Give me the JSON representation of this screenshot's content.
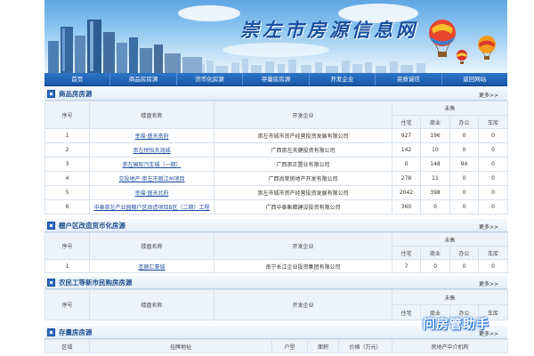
{
  "site": {
    "title": "崇左市房源信息网"
  },
  "nav": {
    "items": [
      "首页",
      "商品房房源",
      "货币化房源",
      "存量房房源",
      "开发企业",
      "资质诚信",
      "返回网站"
    ]
  },
  "sections": {
    "commercial": {
      "title": "商品房房源",
      "more": "更多>>",
      "headers": {
        "no": "序号",
        "name": "楼盘名称",
        "developer": "开发企业",
        "unsold": "未售",
        "res": "住宅",
        "biz": "商业",
        "office": "办公",
        "garage": "车库"
      },
      "rows": [
        {
          "no": "1",
          "name": "幸福·盛天南府",
          "developer": "崇左市城市资产经营投资发展有限公司",
          "res": "927",
          "biz": "196",
          "office": "0",
          "garage": "0"
        },
        {
          "no": "2",
          "name": "崇左悦怡天润城",
          "developer": "广西崇左天健投资有限公司",
          "res": "142",
          "biz": "10",
          "office": "0",
          "garage": "0"
        },
        {
          "no": "3",
          "name": "崇左国际汽车城（一期）",
          "developer": "广西崇正置业有限公司",
          "res": "0",
          "biz": "148",
          "office": "94",
          "garage": "0"
        },
        {
          "no": "4",
          "name": "交投地产·崇左市丽江州项目",
          "developer": "广西尚荣房地产开发有限公司",
          "res": "278",
          "biz": "11",
          "office": "0",
          "garage": "0"
        },
        {
          "no": "5",
          "name": "幸福·盛天北府",
          "developer": "崇左市城市资产经营投资发展有限公司",
          "res": "2042",
          "biz": "398",
          "office": "0",
          "garage": "0"
        },
        {
          "no": "6",
          "name": "中泰崇左产业园棚户区改造项目B区（二期）工程",
          "developer": "广西中泰象都建设投资有限公司",
          "res": "360",
          "biz": "0",
          "office": "0",
          "garage": "0"
        }
      ]
    },
    "shanty": {
      "title": "棚户区改造货币化房源",
      "more": "更多>>",
      "headers": {
        "no": "序号",
        "name": "楼盘名称",
        "developer": "开发企业",
        "unsold": "未售",
        "res": "住宅",
        "biz": "商业",
        "office": "办公",
        "garage": "车库"
      },
      "rows": [
        {
          "no": "1",
          "name": "圣丽汇豪城",
          "developer": "南宁长江企业投资集团有限公司",
          "res": "7",
          "biz": "0",
          "office": "0",
          "garage": "0"
        }
      ]
    },
    "migrant": {
      "title": "农民工等新市民购房房源",
      "more": "更多>>",
      "headers": {
        "no": "序号",
        "name": "楼盘名称",
        "developer": "开发企业",
        "unsold": "未售",
        "res": "住宅",
        "biz": "商业",
        "office": "办公",
        "garage": "车库"
      }
    },
    "stock": {
      "title": "存量房房源",
      "more": "更多>>",
      "headers": {
        "district": "区域",
        "address": "挂牌地址",
        "type": "户型",
        "area": "面积",
        "price": "价格（万元）",
        "agency": "房地产中介机构"
      }
    }
  },
  "watermark": "问房管助手"
}
